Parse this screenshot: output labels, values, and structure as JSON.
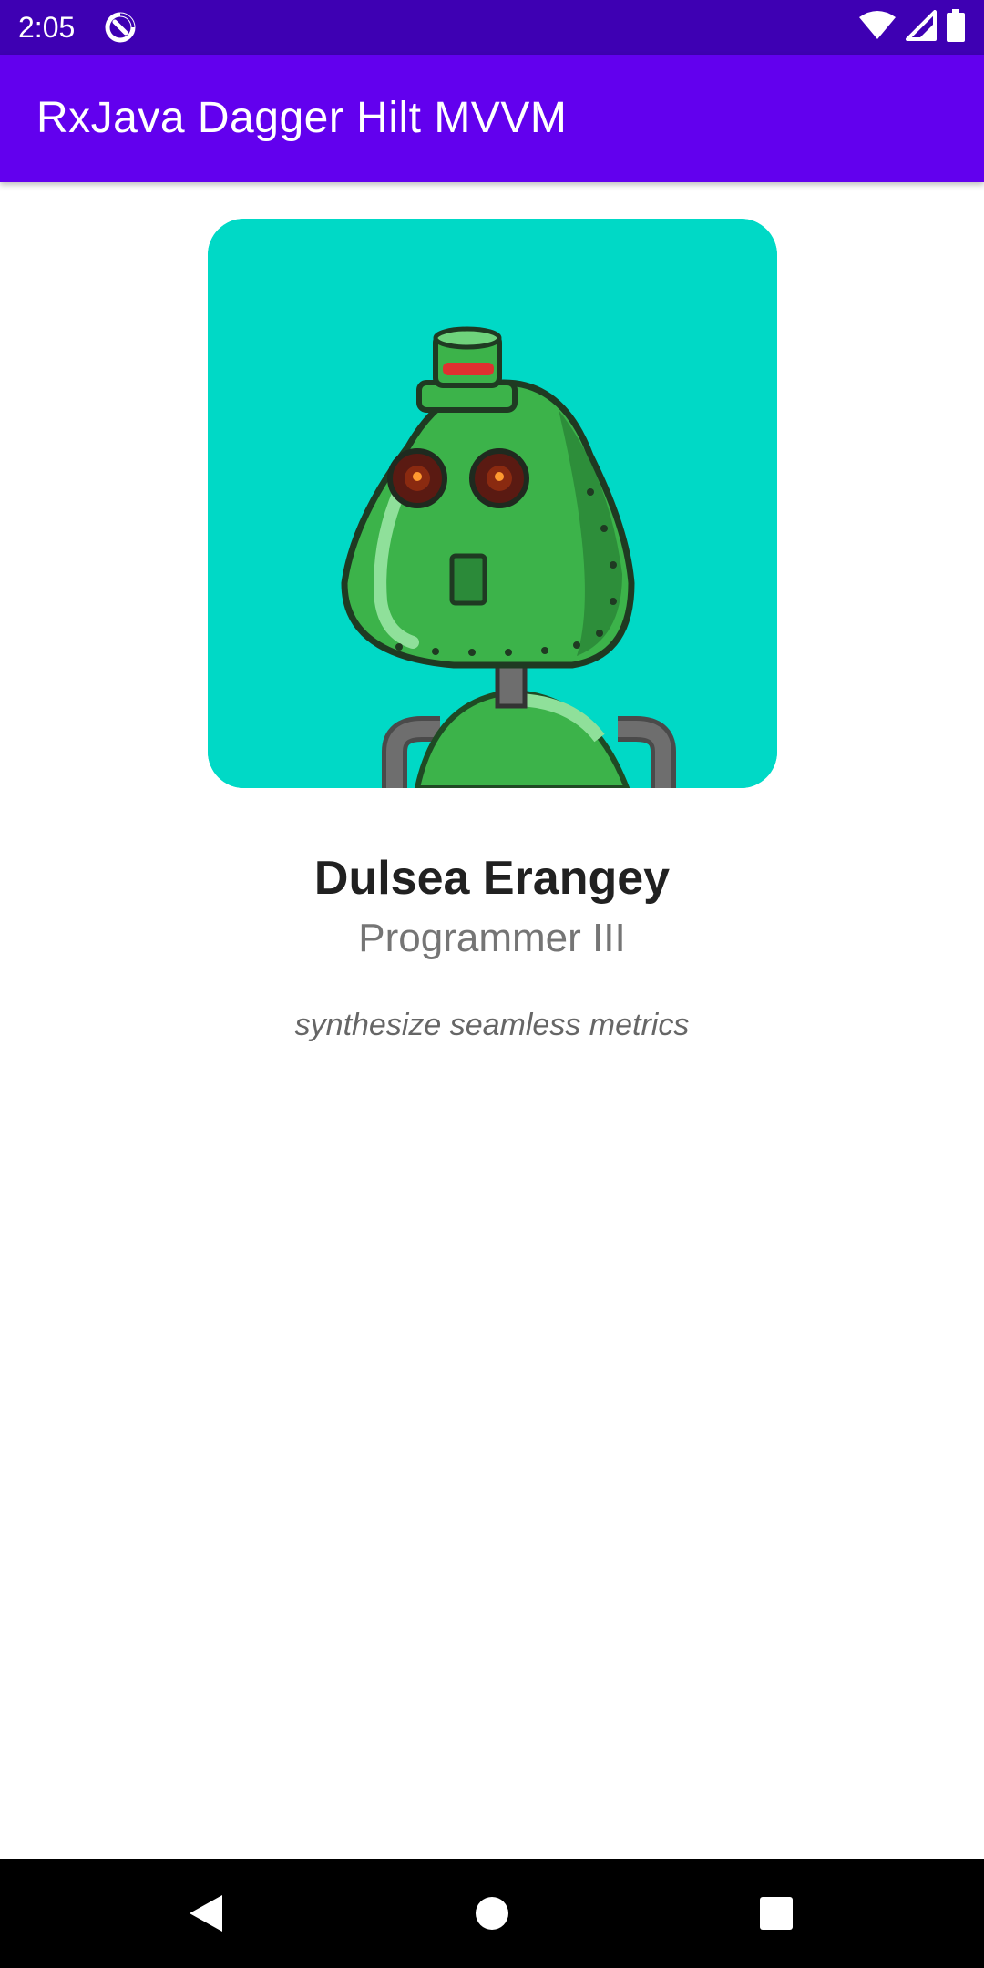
{
  "status_bar": {
    "time": "2:05",
    "icons": [
      "app-notification-icon",
      "wifi-icon",
      "cell-signal-icon",
      "battery-icon"
    ]
  },
  "app_bar": {
    "title": "RxJava Dagger Hilt MVVM"
  },
  "profile": {
    "avatar": "robot-avatar",
    "name": "Dulsea Erangey",
    "job_title": "Programmer III",
    "tagline": "synthesize seamless metrics"
  },
  "nav_bar": {
    "buttons": [
      "back-icon",
      "home-icon",
      "recents-icon"
    ]
  },
  "colors": {
    "status_bar": "#3e00b3",
    "app_bar": "#6200ee",
    "avatar_background": "#00d9c6",
    "robot_green": "#3cb34a"
  }
}
